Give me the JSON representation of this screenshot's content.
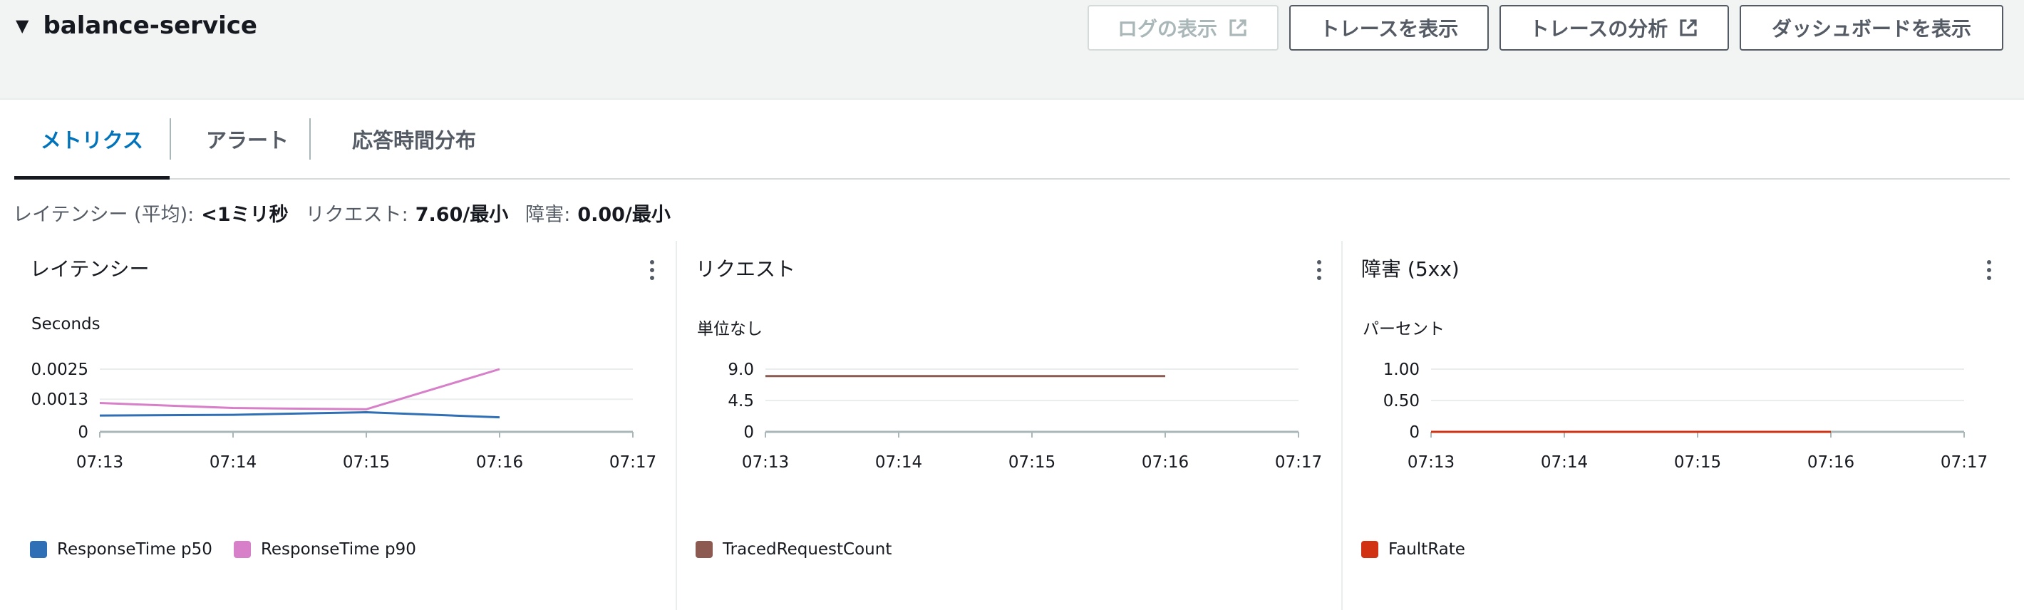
{
  "header": {
    "service_name": "balance-service",
    "buttons": {
      "logs": "ログの表示",
      "traces": "トレースを表示",
      "analyze": "トレースの分析",
      "dashboard": "ダッシュボードを表示"
    }
  },
  "tabs": [
    {
      "label": "メトリクス",
      "active": true
    },
    {
      "label": "アラート",
      "active": false
    },
    {
      "label": "応答時間分布",
      "active": false
    }
  ],
  "summary": {
    "latency_label": "レイテンシー (平均):",
    "latency_value": "<1ミリ秒",
    "request_label": "リクエスト:",
    "request_value": "7.60/最小",
    "fault_label": "障害:",
    "fault_value": "0.00/最小"
  },
  "colors": {
    "p50": "#2f6fb5",
    "p90": "#d77fc8",
    "traced": "#8c5a51",
    "fault": "#d13212"
  },
  "chart_data": [
    {
      "type": "line",
      "title": "レイテンシー",
      "ylabel": "Seconds",
      "x": [
        "07:13",
        "07:14",
        "07:15",
        "07:16",
        "07:17"
      ],
      "ylim": [
        0,
        0.0025
      ],
      "y_ticks": [
        "0.0025",
        "0.0013",
        "0"
      ],
      "y_tick_values": [
        0.0025,
        0.0013,
        0
      ],
      "series": [
        {
          "name": "ResponseTime p50",
          "color": "#2f6fb5",
          "values": [
            0.00065,
            0.00068,
            0.00078,
            0.00058
          ]
        },
        {
          "name": "ResponseTime p90",
          "color": "#d77fc8",
          "values": [
            0.00115,
            0.00095,
            0.0009,
            0.0025
          ]
        }
      ]
    },
    {
      "type": "line",
      "title": "リクエスト",
      "ylabel": "単位なし",
      "x": [
        "07:13",
        "07:14",
        "07:15",
        "07:16",
        "07:17"
      ],
      "ylim": [
        0,
        9.0
      ],
      "y_ticks": [
        "9.0",
        "4.5",
        "0"
      ],
      "y_tick_values": [
        9.0,
        4.5,
        0
      ],
      "series": [
        {
          "name": "TracedRequestCount",
          "color": "#8c5a51",
          "values": [
            8.0,
            8.0,
            8.0,
            8.0
          ]
        }
      ]
    },
    {
      "type": "line",
      "title": "障害 (5xx)",
      "ylabel": "パーセント",
      "x": [
        "07:13",
        "07:14",
        "07:15",
        "07:16",
        "07:17"
      ],
      "ylim": [
        0,
        1.0
      ],
      "y_ticks": [
        "1.00",
        "0.50",
        "0"
      ],
      "y_tick_values": [
        1.0,
        0.5,
        0
      ],
      "series": [
        {
          "name": "FaultRate",
          "color": "#d13212",
          "values": [
            0,
            0,
            0,
            0
          ]
        }
      ]
    }
  ]
}
